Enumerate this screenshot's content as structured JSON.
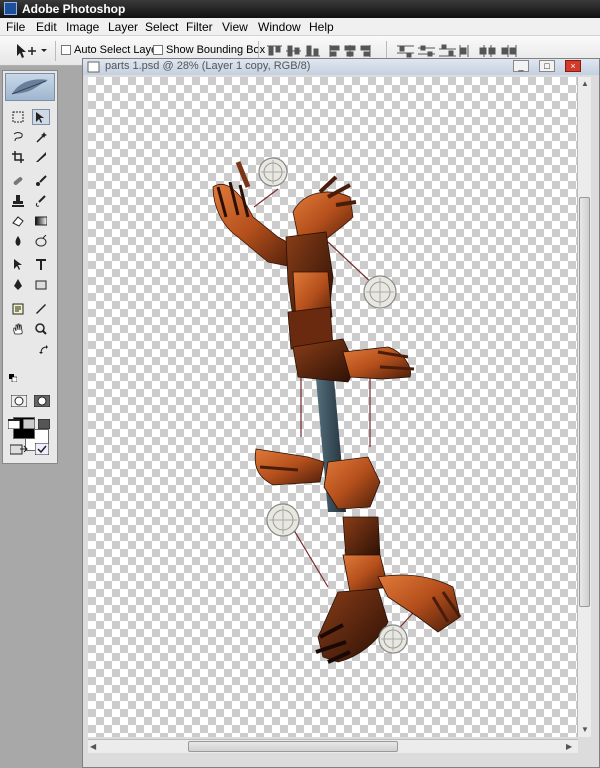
{
  "app": {
    "title": "Adobe Photoshop"
  },
  "menu": [
    "File",
    "Edit",
    "Image",
    "Layer",
    "Select",
    "Filter",
    "View",
    "Window",
    "Help"
  ],
  "options": {
    "auto_select_label": "Auto Select Layer",
    "auto_select_checked": false,
    "show_bbox_label": "Show Bounding Box",
    "show_bbox_checked": false
  },
  "document": {
    "title": "parts 1.psd @ 28% (Layer 1 copy, RGB/8)"
  },
  "colors": {
    "foreground": "#000000",
    "background": "#ffffff",
    "accent": "#d43a2a"
  },
  "tools": [
    "marquee-icon",
    "move-icon",
    "lasso-icon",
    "magic-wand-icon",
    "crop-icon",
    "slice-icon",
    "healing-brush-icon",
    "brush-icon",
    "clone-stamp-icon",
    "history-brush-icon",
    "eraser-icon",
    "gradient-icon",
    "blur-icon",
    "dodge-icon",
    "path-selection-icon",
    "type-icon",
    "pen-icon",
    "shape-icon",
    "notes-icon",
    "eyedropper-icon",
    "hand-icon",
    "zoom-icon"
  ]
}
